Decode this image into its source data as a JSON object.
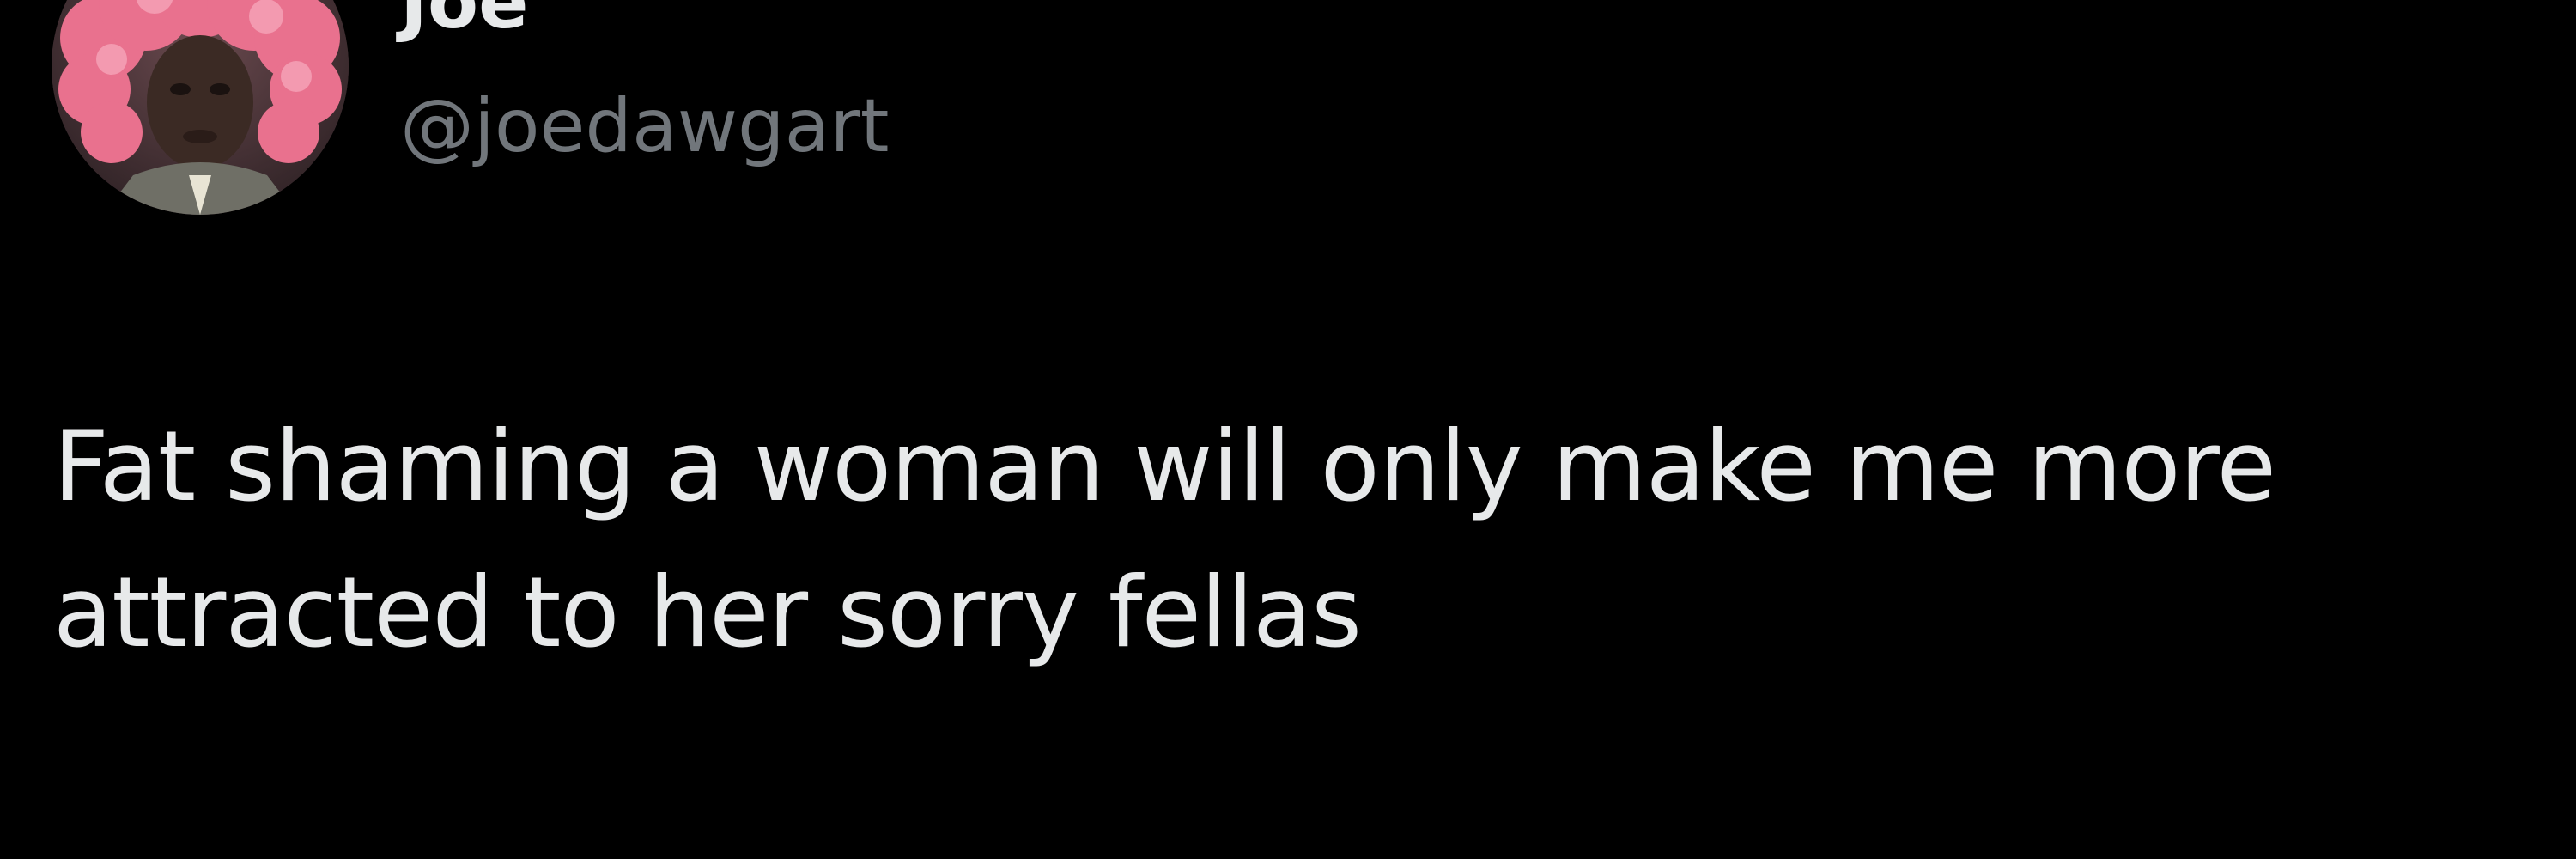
{
  "tweet": {
    "author": {
      "display_name": "Joe",
      "handle": "@joedawgart",
      "avatar_icon": "avatar-photo-pink-wig"
    },
    "text_line_1": "Fat shaming a woman will only make me more",
    "text_line_2": "attracted to her sorry fellas"
  },
  "colors": {
    "background": "#000000",
    "primary_text": "#e7e9ea",
    "secondary_text": "#71767b"
  }
}
